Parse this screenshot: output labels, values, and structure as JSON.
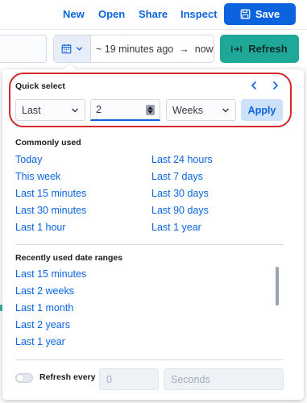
{
  "header": {
    "links": [
      "New",
      "Open",
      "Share",
      "Inspect"
    ],
    "save_label": "Save"
  },
  "toolbar": {
    "date_start": "~ 19 minutes ago",
    "arrow": "→",
    "date_end": "now",
    "refresh_label": "Refresh"
  },
  "quick_select": {
    "title": "Quick select",
    "direction": "Last",
    "amount": "2",
    "unit": "Weeks",
    "apply_label": "Apply"
  },
  "commonly_used": {
    "title": "Commonly used",
    "left": [
      "Today",
      "This week",
      "Last 15 minutes",
      "Last 30 minutes",
      "Last 1 hour"
    ],
    "right": [
      "Last 24 hours",
      "Last 7 days",
      "Last 30 days",
      "Last 90 days",
      "Last 1 year"
    ]
  },
  "recent": {
    "title": "Recently used date ranges",
    "items": [
      "Last 15 minutes",
      "Last 2 weeks",
      "Last 1 month",
      "Last 2 years",
      "Last 1 year"
    ]
  },
  "refresh_every": {
    "label": "Refresh every",
    "value_placeholder": "0",
    "unit_placeholder": "Seconds"
  },
  "colors": {
    "accent": "#0b64dd",
    "refresh_button": "#1fa797",
    "highlight_outline": "#d6262c"
  }
}
